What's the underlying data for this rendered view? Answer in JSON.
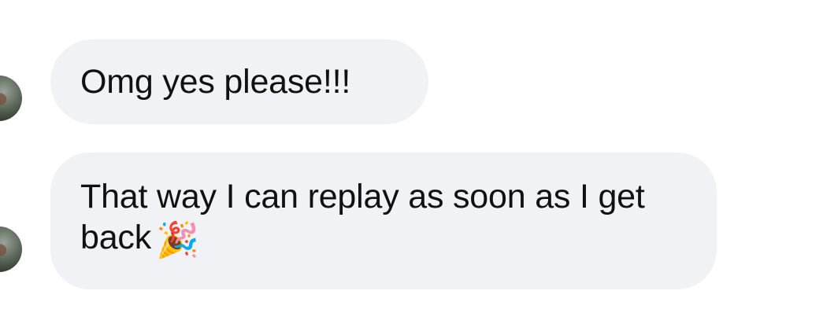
{
  "messages": [
    {
      "text": "Omg yes please!!!",
      "emoji": ""
    },
    {
      "text": "That way I can replay as soon as I get back",
      "emoji": "🎉"
    }
  ],
  "colors": {
    "bubble_background": "#f0f2f5",
    "text": "#111111",
    "page_background": "#ffffff"
  },
  "icons": {
    "party_icon": "party-popper-icon"
  }
}
